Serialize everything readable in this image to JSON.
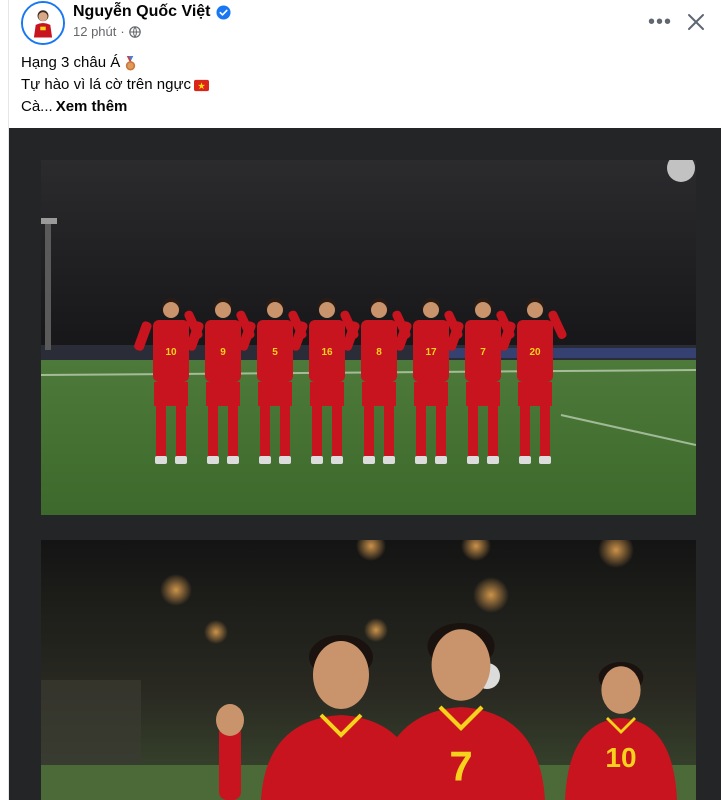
{
  "post": {
    "author": {
      "name": "Nguyễn Quốc Việt",
      "verified": true,
      "avatar_icon": "player-avatar-icon"
    },
    "meta": {
      "time": "12 phút",
      "separator": "·",
      "audience_icon": "globe-icon"
    },
    "actions": {
      "more_icon": "more-options-icon",
      "more_label": "•••",
      "close_icon": "close-icon"
    },
    "caption": {
      "line1": "Hạng 3 châu Á",
      "line1_emoji": "bronze-medal-icon",
      "line2": "Tự hào vì lá cờ trên ngực",
      "line2_emoji": "vietnam-flag-icon",
      "line3": "Cà...",
      "see_more": "Xem thêm"
    },
    "media": {
      "photos": [
        {
          "description_icon": "team-photo"
        },
        {
          "description_icon": "celebration-photo"
        }
      ],
      "jersey_numbers_photo1": [
        "10",
        "9",
        "5",
        "16",
        "8",
        "17",
        "7",
        "20"
      ],
      "jersey_numbers_photo2": [
        "7",
        "10"
      ]
    }
  },
  "colors": {
    "accent_blue": "#1877f2",
    "text_primary": "#050505",
    "text_secondary": "#65676b",
    "media_bg": "#242526",
    "jersey_red": "#c8141e"
  }
}
